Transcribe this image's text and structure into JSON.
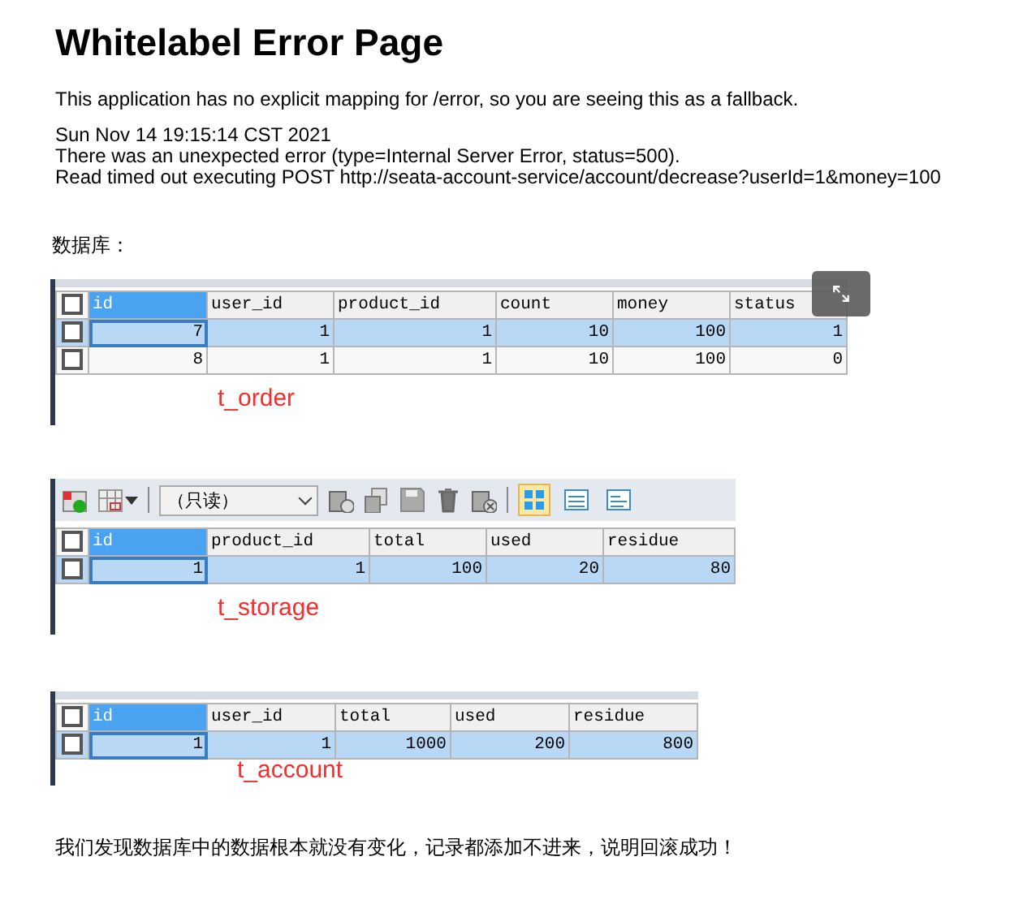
{
  "title": "Whitelabel Error Page",
  "message": "This application has no explicit mapping for /error, so you are seeing this as a fallback.",
  "details": [
    "Sun Nov 14 19:15:14 CST 2021",
    "There was an unexpected error (type=Internal Server Error, status=500).",
    "Read timed out executing POST http://seata-account-service/account/decrease?userId=1&money=100"
  ],
  "section_label": "数据库：",
  "tables": [
    {
      "caption": "t_order",
      "overlay_button": true,
      "all_checked": false,
      "columns": [
        {
          "label": "id",
          "selected": true
        },
        {
          "label": "user_id",
          "selected": false
        },
        {
          "label": "product_id",
          "selected": false
        },
        {
          "label": "count",
          "selected": false
        },
        {
          "label": "money",
          "selected": false
        },
        {
          "label": "status",
          "selected": false
        }
      ],
      "rows": [
        {
          "selected": true,
          "checked": false,
          "cells": [
            "7",
            "1",
            "1",
            "10",
            "100",
            "1"
          ]
        },
        {
          "selected": false,
          "checked": false,
          "cells": [
            "8",
            "1",
            "1",
            "10",
            "100",
            "0"
          ]
        }
      ]
    },
    {
      "caption": "t_storage",
      "all_checked": false,
      "toolbar": {
        "mode": "（只读）",
        "views": [
          {
            "selected": true
          },
          {
            "selected": false
          },
          {
            "selected": false
          }
        ]
      },
      "columns": [
        {
          "label": "id",
          "selected": true
        },
        {
          "label": "product_id",
          "selected": false
        },
        {
          "label": "total",
          "selected": false
        },
        {
          "label": "used",
          "selected": false
        },
        {
          "label": "residue",
          "selected": false
        }
      ],
      "rows": [
        {
          "selected": true,
          "checked": false,
          "cells": [
            "1",
            "1",
            "100",
            "20",
            "80"
          ]
        }
      ]
    },
    {
      "caption": "t_account",
      "all_checked": false,
      "columns": [
        {
          "label": "id",
          "selected": true
        },
        {
          "label": "user_id",
          "selected": false
        },
        {
          "label": "total",
          "selected": false
        },
        {
          "label": "used",
          "selected": false
        },
        {
          "label": "residue",
          "selected": false
        }
      ],
      "rows": [
        {
          "selected": true,
          "checked": false,
          "cells": [
            "1",
            "1",
            "1000",
            "200",
            "800"
          ]
        }
      ]
    }
  ],
  "conclusion": "我们发现数据库中的数据根本就没有变化，记录都添加不进来，说明回滚成功！"
}
